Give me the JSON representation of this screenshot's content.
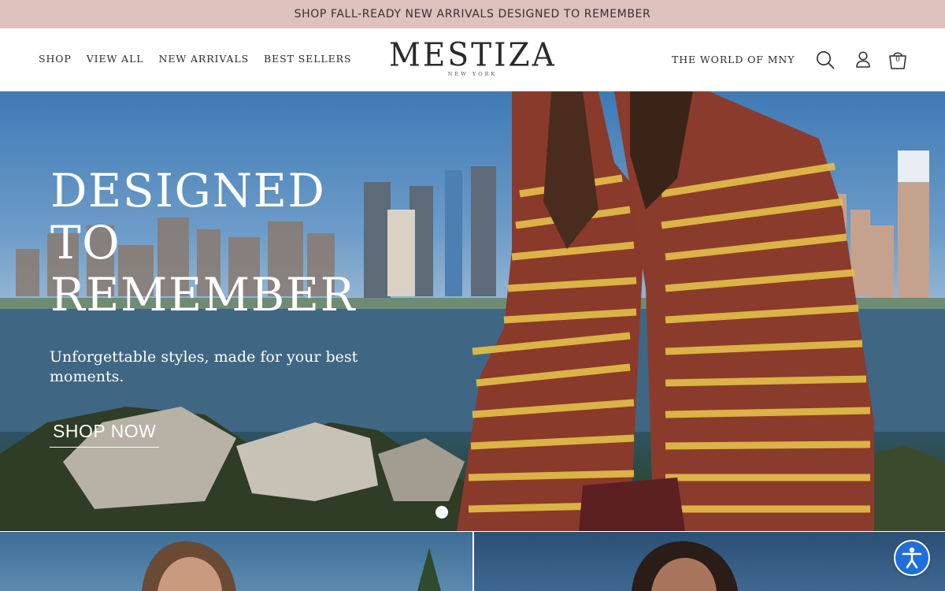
{
  "announcement": {
    "text": "SHOP FALL-READY NEW ARRIVALS DESIGNED TO REMEMBER"
  },
  "header": {
    "nav_left": [
      {
        "label": "SHOP"
      },
      {
        "label": "VIEW ALL"
      },
      {
        "label": "NEW ARRIVALS"
      },
      {
        "label": "BEST SELLERS"
      }
    ],
    "logo": {
      "main": "MESTIZA",
      "sub": "NEW YORK"
    },
    "nav_right": {
      "label": "THE WORLD OF MNY"
    },
    "icons": {
      "search": "search-icon",
      "account": "account-icon",
      "cart": "cart-icon"
    },
    "cart_count": "0"
  },
  "hero": {
    "title_lines": [
      "DESIGNED",
      "TO",
      "REMEMBER"
    ],
    "subtitle": "Unforgettable styles, made for your best moments.",
    "cta_label": "SHOP NOW",
    "slides_total": 1,
    "active_slide": 1
  },
  "colors": {
    "announcement_bg": "#dfc1bd",
    "accessibility_button": "#1e6fd9",
    "hero_text": "#ffffff"
  },
  "accessibility": {
    "icon": "accessibility-icon"
  }
}
